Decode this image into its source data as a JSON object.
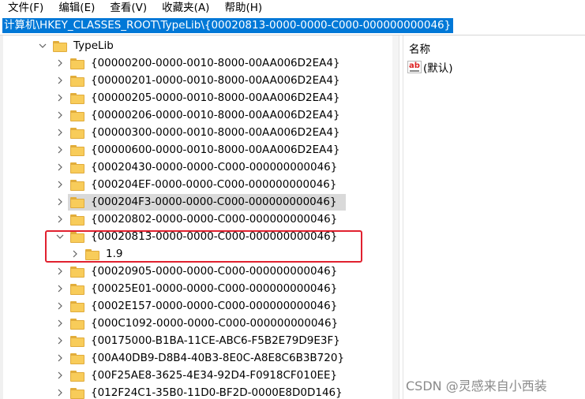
{
  "menu": [
    "文件(F)",
    "编辑(E)",
    "查看(V)",
    "收藏夹(A)",
    "帮助(H)"
  ],
  "address": "计算机\\HKEY_CLASSES_ROOT\\TypeLib\\{00020813-0000-0000-C000-000000000046}",
  "tree": {
    "parent": "TypeLib",
    "items": [
      "{00000200-0000-0010-8000-00AA006D2EA4}",
      "{00000201-0000-0010-8000-00AA006D2EA4}",
      "{00000205-0000-0010-8000-00AA006D2EA4}",
      "{00000206-0000-0010-8000-00AA006D2EA4}",
      "{00000300-0000-0010-8000-00AA006D2EA4}",
      "{00000600-0000-0010-8000-00AA006D2EA4}",
      "{00020430-0000-0000-C000-000000000046}",
      "{000204EF-0000-0000-C000-000000000046}",
      "{000204F3-0000-0000-C000-000000000046}",
      "{00020802-0000-0000-C000-000000000046}",
      "{00020813-0000-0000-C000-000000000046}",
      "1.9",
      "{00020905-0000-0000-C000-000000000046}",
      "{00025E01-0000-0000-C000-000000000046}",
      "{0002E157-0000-0000-C000-000000000046}",
      "{000C1092-0000-0000-C000-000000000046}",
      "{00175000-B1BA-11CE-ABC6-F5B2E79D9E3F}",
      "{00A40DB9-D8B4-40B3-8E0C-A8E8C6B3B720}",
      "{00F25AE8-3625-4E34-92D4-F0918CF010EE}",
      "{012F24C1-35B0-11D0-BF2D-0000E8D0D146}"
    ]
  },
  "values": {
    "column_name": "名称",
    "default_value": "(默认)",
    "icon": "ab-string-icon"
  },
  "watermark": "CSDN @灵感来自小西装",
  "colors": {
    "selection": "#0078d7",
    "highlight_box": "#e1212f",
    "folder": "#f8cc5a"
  }
}
